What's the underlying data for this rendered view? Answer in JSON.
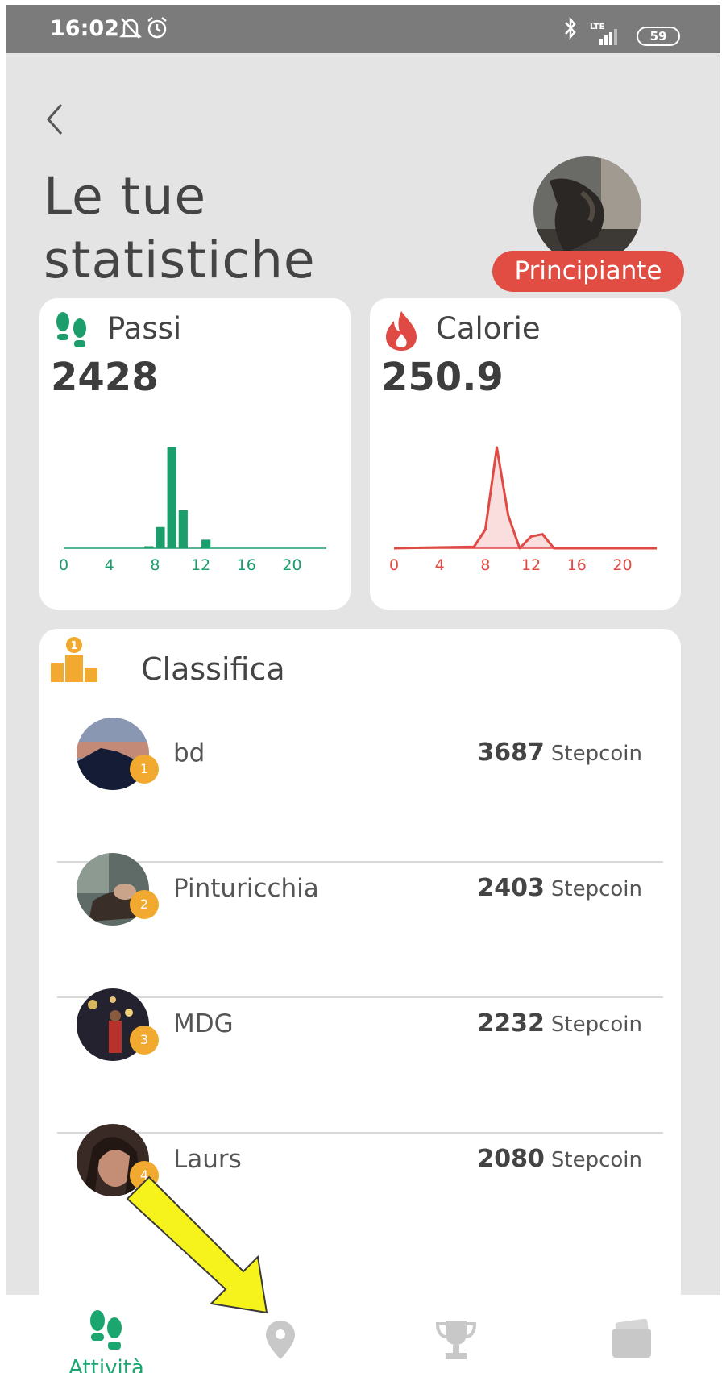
{
  "status_bar": {
    "time": "16:02",
    "battery": "59",
    "network": "LTE"
  },
  "header": {
    "title_line1": "Le tue",
    "title_line2": "statistiche",
    "level_badge": "Principiante"
  },
  "cards": {
    "steps": {
      "title": "Passi",
      "value": "2428",
      "icon": "footsteps-icon",
      "color": "#1b9e6c"
    },
    "calories": {
      "title": "Calorie",
      "value": "250.9",
      "icon": "flame-icon",
      "color": "#e04a45"
    }
  },
  "chart_data": [
    {
      "type": "bar",
      "title": "Passi",
      "x_ticks": [
        "0",
        "4",
        "8",
        "12",
        "16",
        "20"
      ],
      "x": [
        7,
        8,
        9,
        10,
        12
      ],
      "values": [
        40,
        420,
        2000,
        760,
        170
      ],
      "xlim": [
        0,
        23
      ]
    },
    {
      "type": "area",
      "title": "Calorie",
      "x_ticks": [
        "0",
        "4",
        "8",
        "12",
        "16",
        "20"
      ],
      "x": [
        0,
        7,
        8,
        9,
        10,
        11,
        12,
        13,
        14,
        23
      ],
      "values": [
        0,
        3,
        40,
        215,
        70,
        0,
        25,
        30,
        0,
        0
      ],
      "xlim": [
        0,
        23
      ]
    }
  ],
  "leaderboard": {
    "title": "Classifica",
    "unit": "Stepcoin",
    "rows": [
      {
        "rank": "1",
        "name": "bd",
        "score": "3687"
      },
      {
        "rank": "2",
        "name": "Pinturicchia",
        "score": "2403"
      },
      {
        "rank": "3",
        "name": "MDG",
        "score": "2232"
      },
      {
        "rank": "4",
        "name": "Laurs",
        "score": "2080"
      }
    ]
  },
  "nav": {
    "activity_label": "Attività",
    "active_color": "#1ca66f",
    "inactive_color": "#c8c8c8"
  }
}
